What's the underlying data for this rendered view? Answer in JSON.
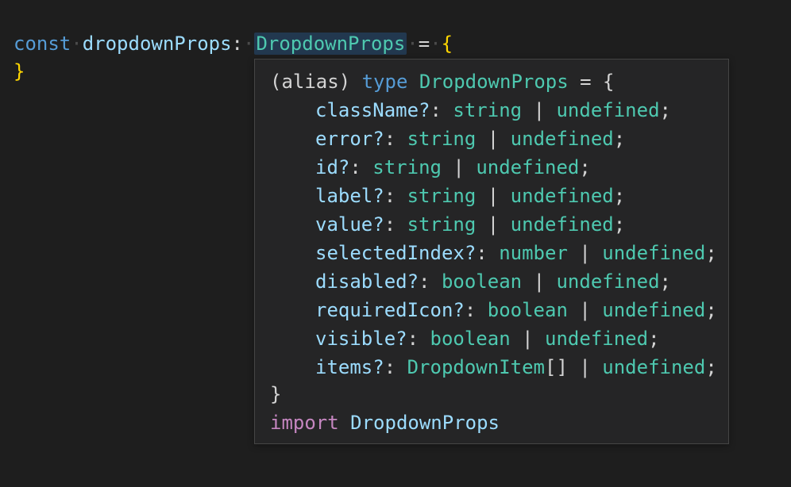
{
  "editor": {
    "line1": {
      "keyword": "const",
      "variable": "dropdownProps",
      "colon": ":",
      "type_name": "DropdownProps",
      "equals": "=",
      "open_brace": "{"
    },
    "line2": {
      "close_brace": "}"
    }
  },
  "hover": {
    "header": {
      "alias": "(alias)",
      "type_keyword": "type",
      "type_name": "DropdownProps",
      "equals_brace": "= {"
    },
    "fields": [
      {
        "name": "className?",
        "colon": ":",
        "type": "string",
        "pipe": "|",
        "undef": "undefined",
        "semi": ";"
      },
      {
        "name": "error?",
        "colon": ":",
        "type": "string",
        "pipe": "|",
        "undef": "undefined",
        "semi": ";"
      },
      {
        "name": "id?",
        "colon": ":",
        "type": "string",
        "pipe": "|",
        "undef": "undefined",
        "semi": ";"
      },
      {
        "name": "label?",
        "colon": ":",
        "type": "string",
        "pipe": "|",
        "undef": "undefined",
        "semi": ";"
      },
      {
        "name": "value?",
        "colon": ":",
        "type": "string",
        "pipe": "|",
        "undef": "undefined",
        "semi": ";"
      },
      {
        "name": "selectedIndex?",
        "colon": ":",
        "type": "number",
        "pipe": "|",
        "undef": "undefined",
        "semi": ";"
      },
      {
        "name": "disabled?",
        "colon": ":",
        "type": "boolean",
        "pipe": "|",
        "undef": "undefined",
        "semi": ";"
      },
      {
        "name": "requiredIcon?",
        "colon": ":",
        "type": "boolean",
        "pipe": "|",
        "undef": "undefined",
        "semi": ";"
      },
      {
        "name": "visible?",
        "colon": ":",
        "type": "boolean",
        "pipe": "|",
        "undef": "undefined",
        "semi": ";"
      },
      {
        "name": "items?",
        "colon": ":",
        "type": "DropdownItem",
        "array": "[]",
        "pipe": "|",
        "undef": "undefined",
        "semi": ";"
      }
    ],
    "closing": "}",
    "import_line": {
      "keyword": "import",
      "name": "DropdownProps"
    }
  },
  "colors": {
    "background": "#1e1e1e",
    "hover_background": "#252526",
    "hover_border": "#454545",
    "keyword": "#569cd6",
    "variable": "#9cdcfe",
    "type": "#4ec9b0",
    "brace": "#ffd700",
    "import_keyword": "#c586c0",
    "punctuation": "#d4d4d4"
  }
}
